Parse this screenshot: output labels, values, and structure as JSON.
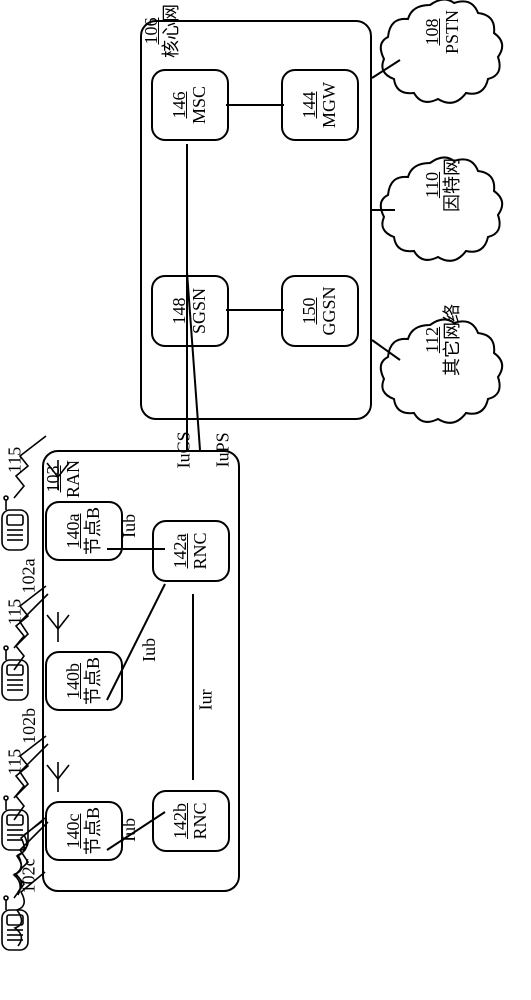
{
  "ran": {
    "id": "103",
    "name": "RAN"
  },
  "core": {
    "id": "106",
    "name": "核心网"
  },
  "nodeB": {
    "a": {
      "id": "140a",
      "name": "节点B"
    },
    "b": {
      "id": "140b",
      "name": "节点B"
    },
    "c": {
      "id": "140c",
      "name": "节点B"
    }
  },
  "rnc": {
    "a": {
      "id": "142a",
      "name": "RNC"
    },
    "b": {
      "id": "142b",
      "name": "RNC"
    }
  },
  "msc": {
    "id": "146",
    "name": "MSC"
  },
  "mgw": {
    "id": "144",
    "name": "MGW"
  },
  "sgsn": {
    "id": "148",
    "name": "SGSN"
  },
  "ggsn": {
    "id": "150",
    "name": "GGSN"
  },
  "pstn": {
    "id": "108",
    "name": "PSTN"
  },
  "internet": {
    "id": "110",
    "name": "因特网"
  },
  "other": {
    "id": "112",
    "name": "其它网络"
  },
  "ue": {
    "a": "102a",
    "b": "102b",
    "c": "102c"
  },
  "air": {
    "a": "115",
    "b": "115",
    "c": "115"
  },
  "if": {
    "iub": "Iub",
    "iur": "Iur",
    "iucs": "IuCS",
    "iups": "IuPS"
  }
}
